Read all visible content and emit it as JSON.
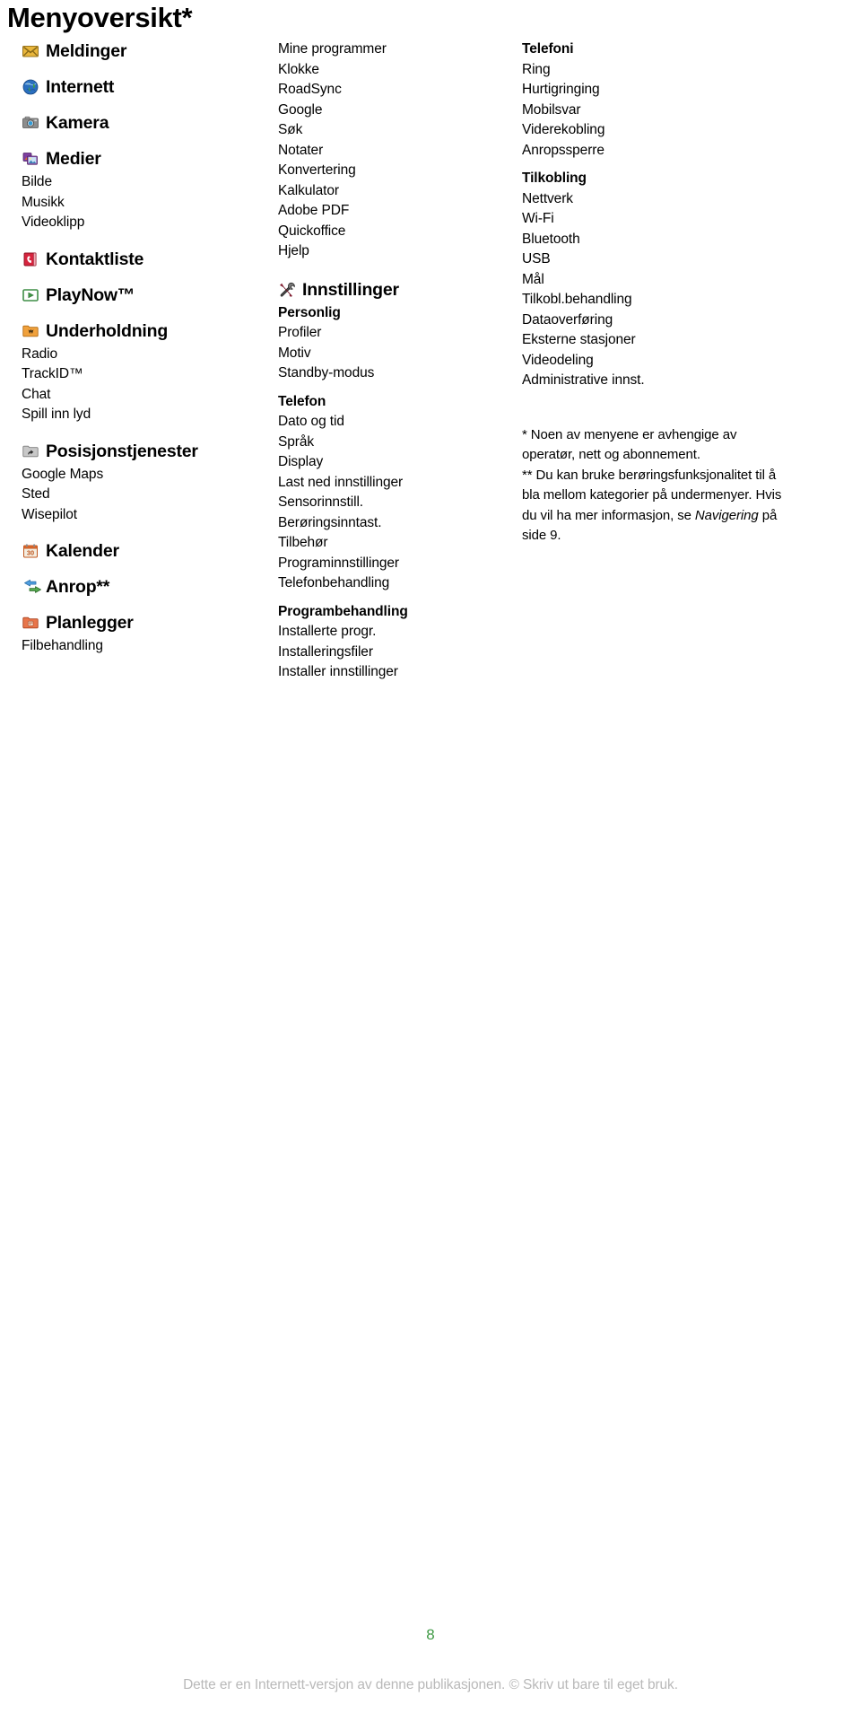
{
  "page": {
    "title": "Menyoversikt*",
    "number": "8",
    "legal": "Dette er en Internett-versjon av denne publikasjonen. © Skriv ut bare til eget bruk."
  },
  "columns": [
    {
      "id": "column-1",
      "groups": [
        {
          "icon": "envelope-icon",
          "label": "Meldinger",
          "items": []
        },
        {
          "icon": "globe-icon",
          "label": "Internett",
          "items": []
        },
        {
          "icon": "camera-icon",
          "label": "Kamera",
          "items": []
        },
        {
          "icon": "media-icon",
          "label": "Medier",
          "items": [
            "Bilde",
            "Musikk",
            "Videoklipp"
          ]
        },
        {
          "icon": "contacts-icon",
          "label": "Kontaktliste",
          "items": []
        },
        {
          "icon": "playnow-icon",
          "label": "PlayNow™",
          "items": []
        },
        {
          "icon": "entertainment-folder-icon",
          "label": "Underholdning",
          "items": [
            "Radio",
            "TrackID™",
            "Chat",
            "Spill inn lyd"
          ]
        },
        {
          "icon": "location-folder-icon",
          "label": "Posisjonstjenester",
          "items": [
            "Google Maps",
            "Sted",
            "Wisepilot"
          ]
        },
        {
          "icon": "calendar-icon",
          "label": "Kalender",
          "items": []
        },
        {
          "icon": "calls-icon",
          "label": "Anrop**",
          "items": []
        },
        {
          "icon": "organizer-folder-icon",
          "label": "Planlegger",
          "items": [
            "Filbehandling"
          ]
        }
      ]
    },
    {
      "id": "column-2",
      "plain_items": [
        "Mine programmer",
        "Klokke",
        "RoadSync",
        "Google",
        "Søk",
        "Notater",
        "Konvertering",
        "Kalkulator",
        "Adobe PDF",
        "Quickoffice",
        "Hjelp"
      ],
      "settings": {
        "icon": "tools-icon",
        "label": "Innstillinger",
        "sections": [
          {
            "head": "Personlig",
            "items": [
              "Profiler",
              "Motiv",
              "Standby-modus"
            ]
          },
          {
            "head": "Telefon",
            "items": [
              "Dato og tid",
              "Språk",
              "Display",
              "Last ned innstillinger",
              "Sensorinnstill.",
              "Berøringsinntast.",
              "Tilbehør",
              "Programinnstillinger",
              "Telefonbehandling"
            ]
          },
          {
            "head": "Programbehandling",
            "items": [
              "Installerte progr.",
              "Installeringsfiler",
              "Installer innstillinger"
            ]
          }
        ]
      }
    },
    {
      "id": "column-3",
      "sections": [
        {
          "head": "Telefoni",
          "items": [
            "Ring",
            "Hurtigringing",
            "Mobilsvar",
            "Viderekobling",
            "Anropssperre"
          ]
        },
        {
          "head": "Tilkobling",
          "items": [
            "Nettverk",
            "Wi-Fi",
            "Bluetooth",
            "USB",
            "Mål",
            "Tilkobl.behandling",
            "Dataoverføring",
            "Eksterne stasjoner",
            "Videodeling",
            "Administrative innst."
          ]
        }
      ],
      "footnotes": {
        "one": "* Noen av menyene er avhengige av operatør, nett og abonnement.",
        "two_a": "** Du kan bruke berøringsfunksjonalitet til å bla mellom kategorier på undermenyer. Hvis du vil ha mer informasjon, se ",
        "two_em": "Navigering",
        "two_b": " på side 9."
      }
    }
  ],
  "colors": {
    "page_number": "#3f9a45",
    "legal_text": "#b9b9b9",
    "body_text": "#000000"
  }
}
